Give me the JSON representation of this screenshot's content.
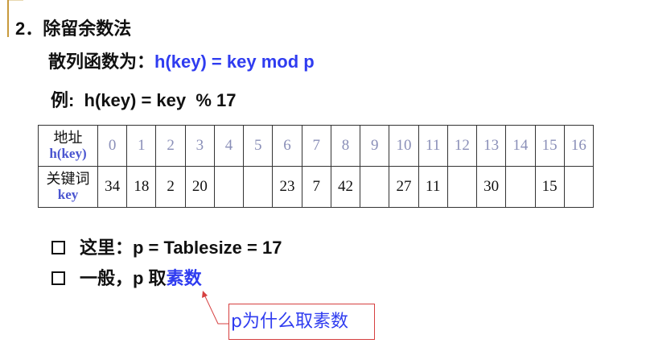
{
  "heading": "2．除留余数法",
  "hash_function": {
    "label": "散列函数为：",
    "formula": "h(key) = key mod p"
  },
  "example": "例:  h(key) = key  % 17",
  "table": {
    "row1_header": [
      "地址",
      "h(key)"
    ],
    "row2_header": [
      "关键词",
      "key"
    ],
    "addresses": [
      "0",
      "1",
      "2",
      "3",
      "4",
      "5",
      "6",
      "7",
      "8",
      "9",
      "10",
      "11",
      "12",
      "13",
      "14",
      "15",
      "16"
    ],
    "keys": [
      "34",
      "18",
      "2",
      "20",
      "",
      "",
      "23",
      "7",
      "42",
      "",
      "27",
      "11",
      "",
      "30",
      "",
      "15",
      ""
    ]
  },
  "bullets": [
    {
      "text": "这里：p = Tablesize = 17",
      "highlight": ""
    },
    {
      "text": "一般，p 取",
      "highlight": "素数"
    }
  ],
  "callout": "p为什么取素数",
  "colors": {
    "accent_blue": "#2f3cf0",
    "callout_border": "#d64040",
    "index_gray": "#8a8fb8"
  }
}
